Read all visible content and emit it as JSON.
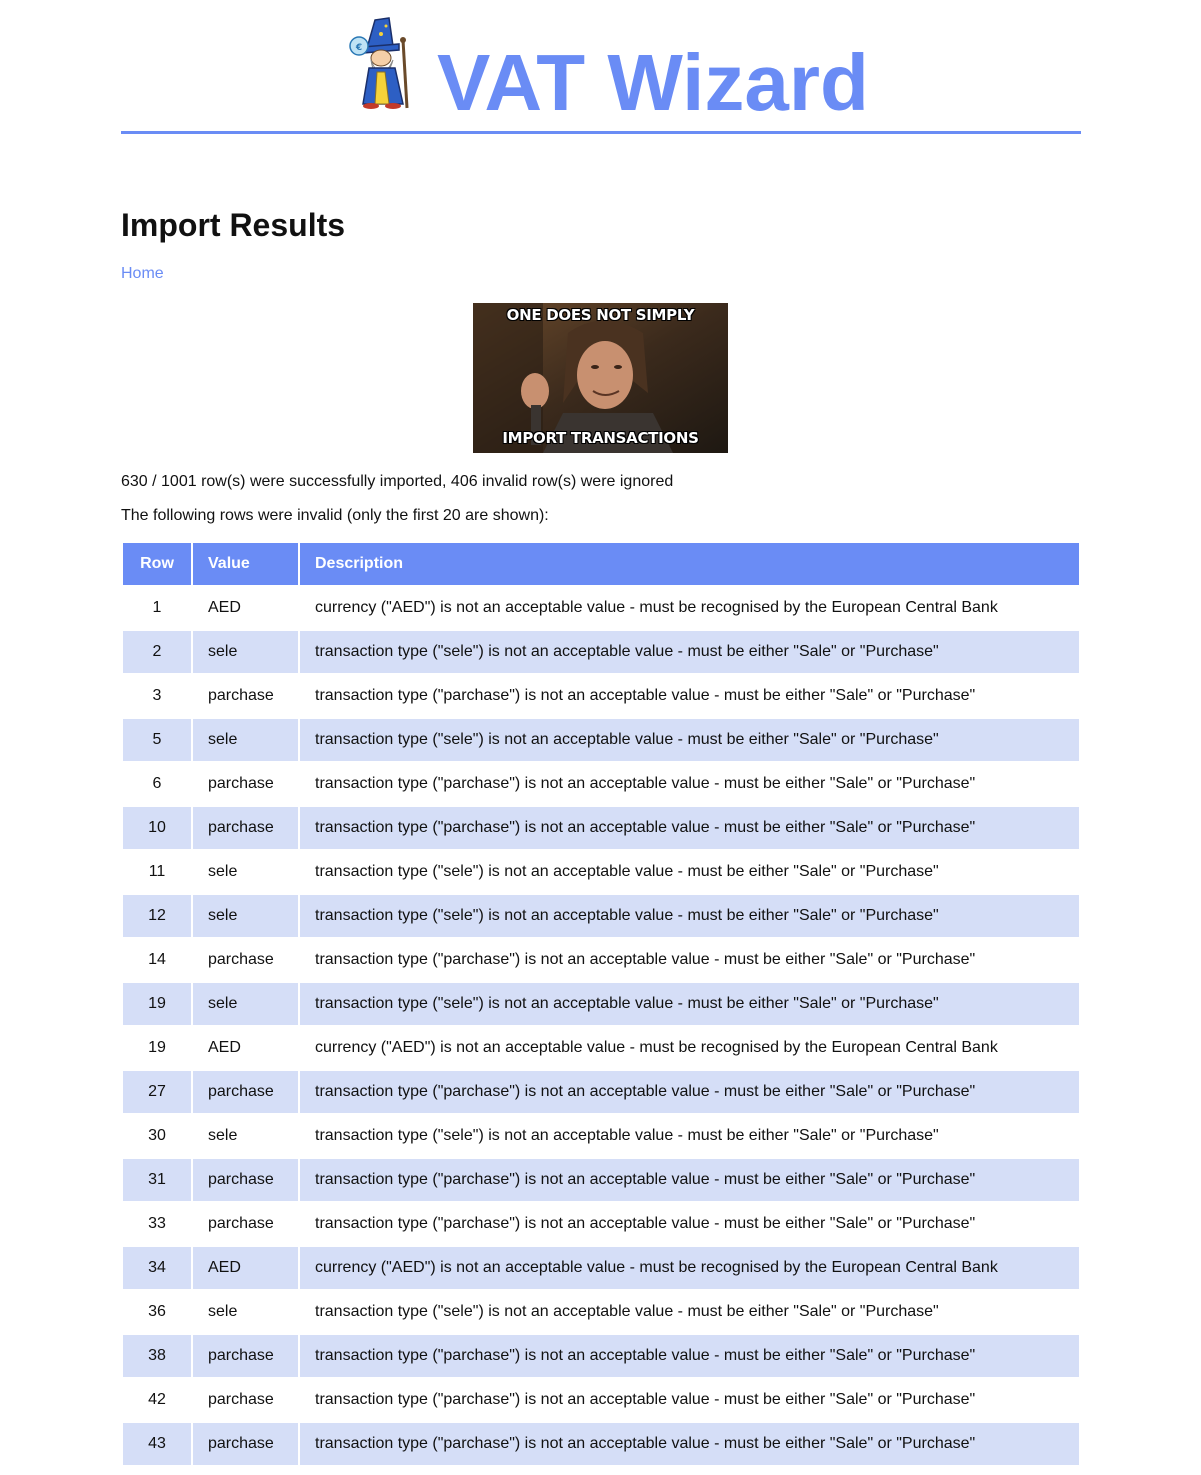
{
  "header": {
    "site_title": "VAT Wizard",
    "logo_icon": "wizard-mascot-icon",
    "accent_color": "#6a8cf5"
  },
  "page": {
    "title": "Import Results",
    "home_link": "Home"
  },
  "meme": {
    "top_text": "ONE DOES NOT SIMPLY",
    "bottom_text": "IMPORT TRANSACTIONS"
  },
  "summary": {
    "imported_text": "630 / 1001 row(s) were successfully imported, 406 invalid row(s) were ignored",
    "invalid_note": "The following rows were invalid (only the first 20 are shown):"
  },
  "table": {
    "headers": {
      "row": "Row",
      "value": "Value",
      "description": "Description"
    },
    "header_color": "#6a8cf5",
    "stripe_color": "#d5def7",
    "rows": [
      {
        "row": "1",
        "value": "AED",
        "description": "currency (\"AED\") is not an acceptable value - must be recognised by the European Central Bank"
      },
      {
        "row": "2",
        "value": "sele",
        "description": "transaction type (\"sele\") is not an acceptable value - must be either \"Sale\" or \"Purchase\""
      },
      {
        "row": "3",
        "value": "parchase",
        "description": "transaction type (\"parchase\") is not an acceptable value - must be either \"Sale\" or \"Purchase\""
      },
      {
        "row": "5",
        "value": "sele",
        "description": "transaction type (\"sele\") is not an acceptable value - must be either \"Sale\" or \"Purchase\""
      },
      {
        "row": "6",
        "value": "parchase",
        "description": "transaction type (\"parchase\") is not an acceptable value - must be either \"Sale\" or \"Purchase\""
      },
      {
        "row": "10",
        "value": "parchase",
        "description": "transaction type (\"parchase\") is not an acceptable value - must be either \"Sale\" or \"Purchase\""
      },
      {
        "row": "11",
        "value": "sele",
        "description": "transaction type (\"sele\") is not an acceptable value - must be either \"Sale\" or \"Purchase\""
      },
      {
        "row": "12",
        "value": "sele",
        "description": "transaction type (\"sele\") is not an acceptable value - must be either \"Sale\" or \"Purchase\""
      },
      {
        "row": "14",
        "value": "parchase",
        "description": "transaction type (\"parchase\") is not an acceptable value - must be either \"Sale\" or \"Purchase\""
      },
      {
        "row": "19",
        "value": "sele",
        "description": "transaction type (\"sele\") is not an acceptable value - must be either \"Sale\" or \"Purchase\""
      },
      {
        "row": "19",
        "value": "AED",
        "description": "currency (\"AED\") is not an acceptable value - must be recognised by the European Central Bank"
      },
      {
        "row": "27",
        "value": "parchase",
        "description": "transaction type (\"parchase\") is not an acceptable value - must be either \"Sale\" or \"Purchase\""
      },
      {
        "row": "30",
        "value": "sele",
        "description": "transaction type (\"sele\") is not an acceptable value - must be either \"Sale\" or \"Purchase\""
      },
      {
        "row": "31",
        "value": "parchase",
        "description": "transaction type (\"parchase\") is not an acceptable value - must be either \"Sale\" or \"Purchase\""
      },
      {
        "row": "33",
        "value": "parchase",
        "description": "transaction type (\"parchase\") is not an acceptable value - must be either \"Sale\" or \"Purchase\""
      },
      {
        "row": "34",
        "value": "AED",
        "description": "currency (\"AED\") is not an acceptable value - must be recognised by the European Central Bank"
      },
      {
        "row": "36",
        "value": "sele",
        "description": "transaction type (\"sele\") is not an acceptable value - must be either \"Sale\" or \"Purchase\""
      },
      {
        "row": "38",
        "value": "parchase",
        "description": "transaction type (\"parchase\") is not an acceptable value - must be either \"Sale\" or \"Purchase\""
      },
      {
        "row": "42",
        "value": "parchase",
        "description": "transaction type (\"parchase\") is not an acceptable value - must be either \"Sale\" or \"Purchase\""
      },
      {
        "row": "43",
        "value": "parchase",
        "description": "transaction type (\"parchase\") is not an acceptable value - must be either \"Sale\" or \"Purchase\""
      }
    ]
  }
}
